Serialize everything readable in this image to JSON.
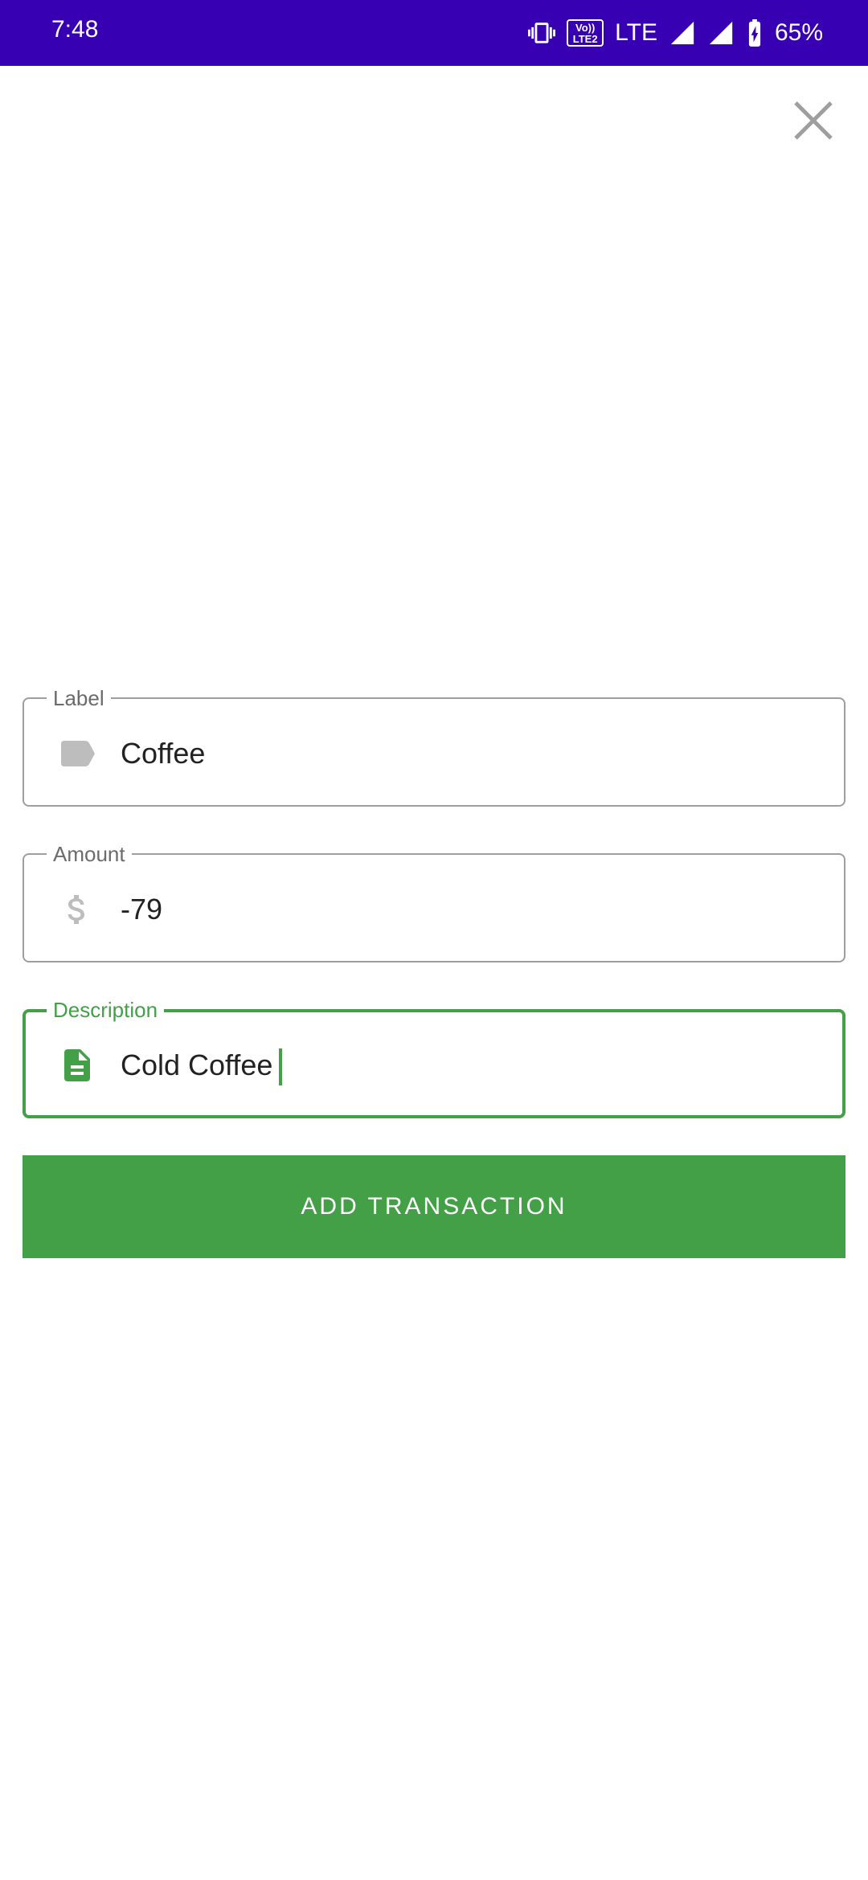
{
  "status_bar": {
    "time": "7:48",
    "volte_line1": "Vo))",
    "volte_line2": "LTE2",
    "network": "LTE",
    "battery": "65%"
  },
  "icons": {
    "vibrate": "vibrate-icon",
    "volte": "volte-icon",
    "signal": "signal-icon",
    "battery": "battery-charging-icon",
    "close": "close-icon",
    "label": "label-tag-icon",
    "amount": "dollar-icon",
    "description": "document-icon"
  },
  "form": {
    "label_field": {
      "label": "Label",
      "value": "Coffee"
    },
    "amount_field": {
      "label": "Amount",
      "value": "-79"
    },
    "description_field": {
      "label": "Description",
      "value": "Cold Coffee"
    },
    "submit_label": "ADD TRANSACTION"
  },
  "colors": {
    "status_bar": "#3700b3",
    "accent": "#43a047",
    "outline": "#9e9e9e",
    "icon_gray": "#bdbdbd"
  }
}
